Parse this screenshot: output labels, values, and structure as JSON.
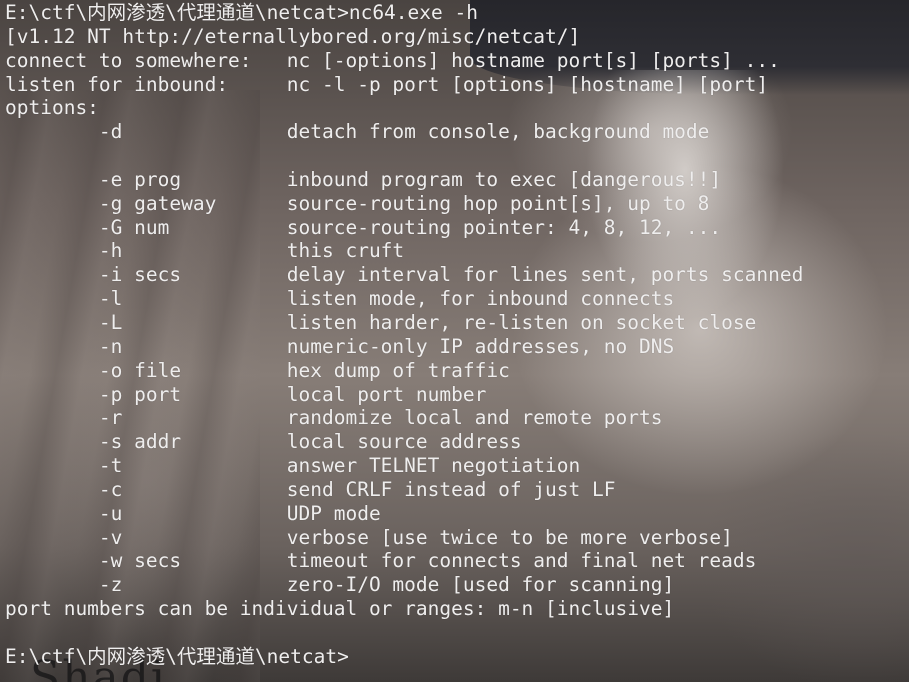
{
  "colors": {
    "foreground": "#efeeee",
    "background_base": "#6e6460"
  },
  "terminal": {
    "lines": [
      "E:\\ctf\\内网渗透\\代理通道\\netcat>nc64.exe -h",
      "[v1.12 NT http://eternallybored.org/misc/netcat/]",
      "connect to somewhere:   nc [-options] hostname port[s] [ports] ...",
      "listen for inbound:     nc -l -p port [options] [hostname] [port]",
      "options:",
      "        -d              detach from console, background mode",
      "",
      "        -e prog         inbound program to exec [dangerous!!]",
      "        -g gateway      source-routing hop point[s], up to 8",
      "        -G num          source-routing pointer: 4, 8, 12, ...",
      "        -h              this cruft",
      "        -i secs         delay interval for lines sent, ports scanned",
      "        -l              listen mode, for inbound connects",
      "        -L              listen harder, re-listen on socket close",
      "        -n              numeric-only IP addresses, no DNS",
      "        -o file         hex dump of traffic",
      "        -p port         local port number",
      "        -r              randomize local and remote ports",
      "        -s addr         local source address",
      "        -t              answer TELNET negotiation",
      "        -c              send CRLF instead of just LF",
      "        -u              UDP mode",
      "        -v              verbose [use twice to be more verbose]",
      "        -w secs         timeout for connects and final net reads",
      "        -z              zero-I/O mode [used for scanning]",
      "port numbers can be individual or ranges: m-n [inclusive]",
      "",
      "E:\\ctf\\内网渗透\\代理通道\\netcat>"
    ]
  },
  "wallpaper": {
    "visible_text": "Shadi"
  }
}
